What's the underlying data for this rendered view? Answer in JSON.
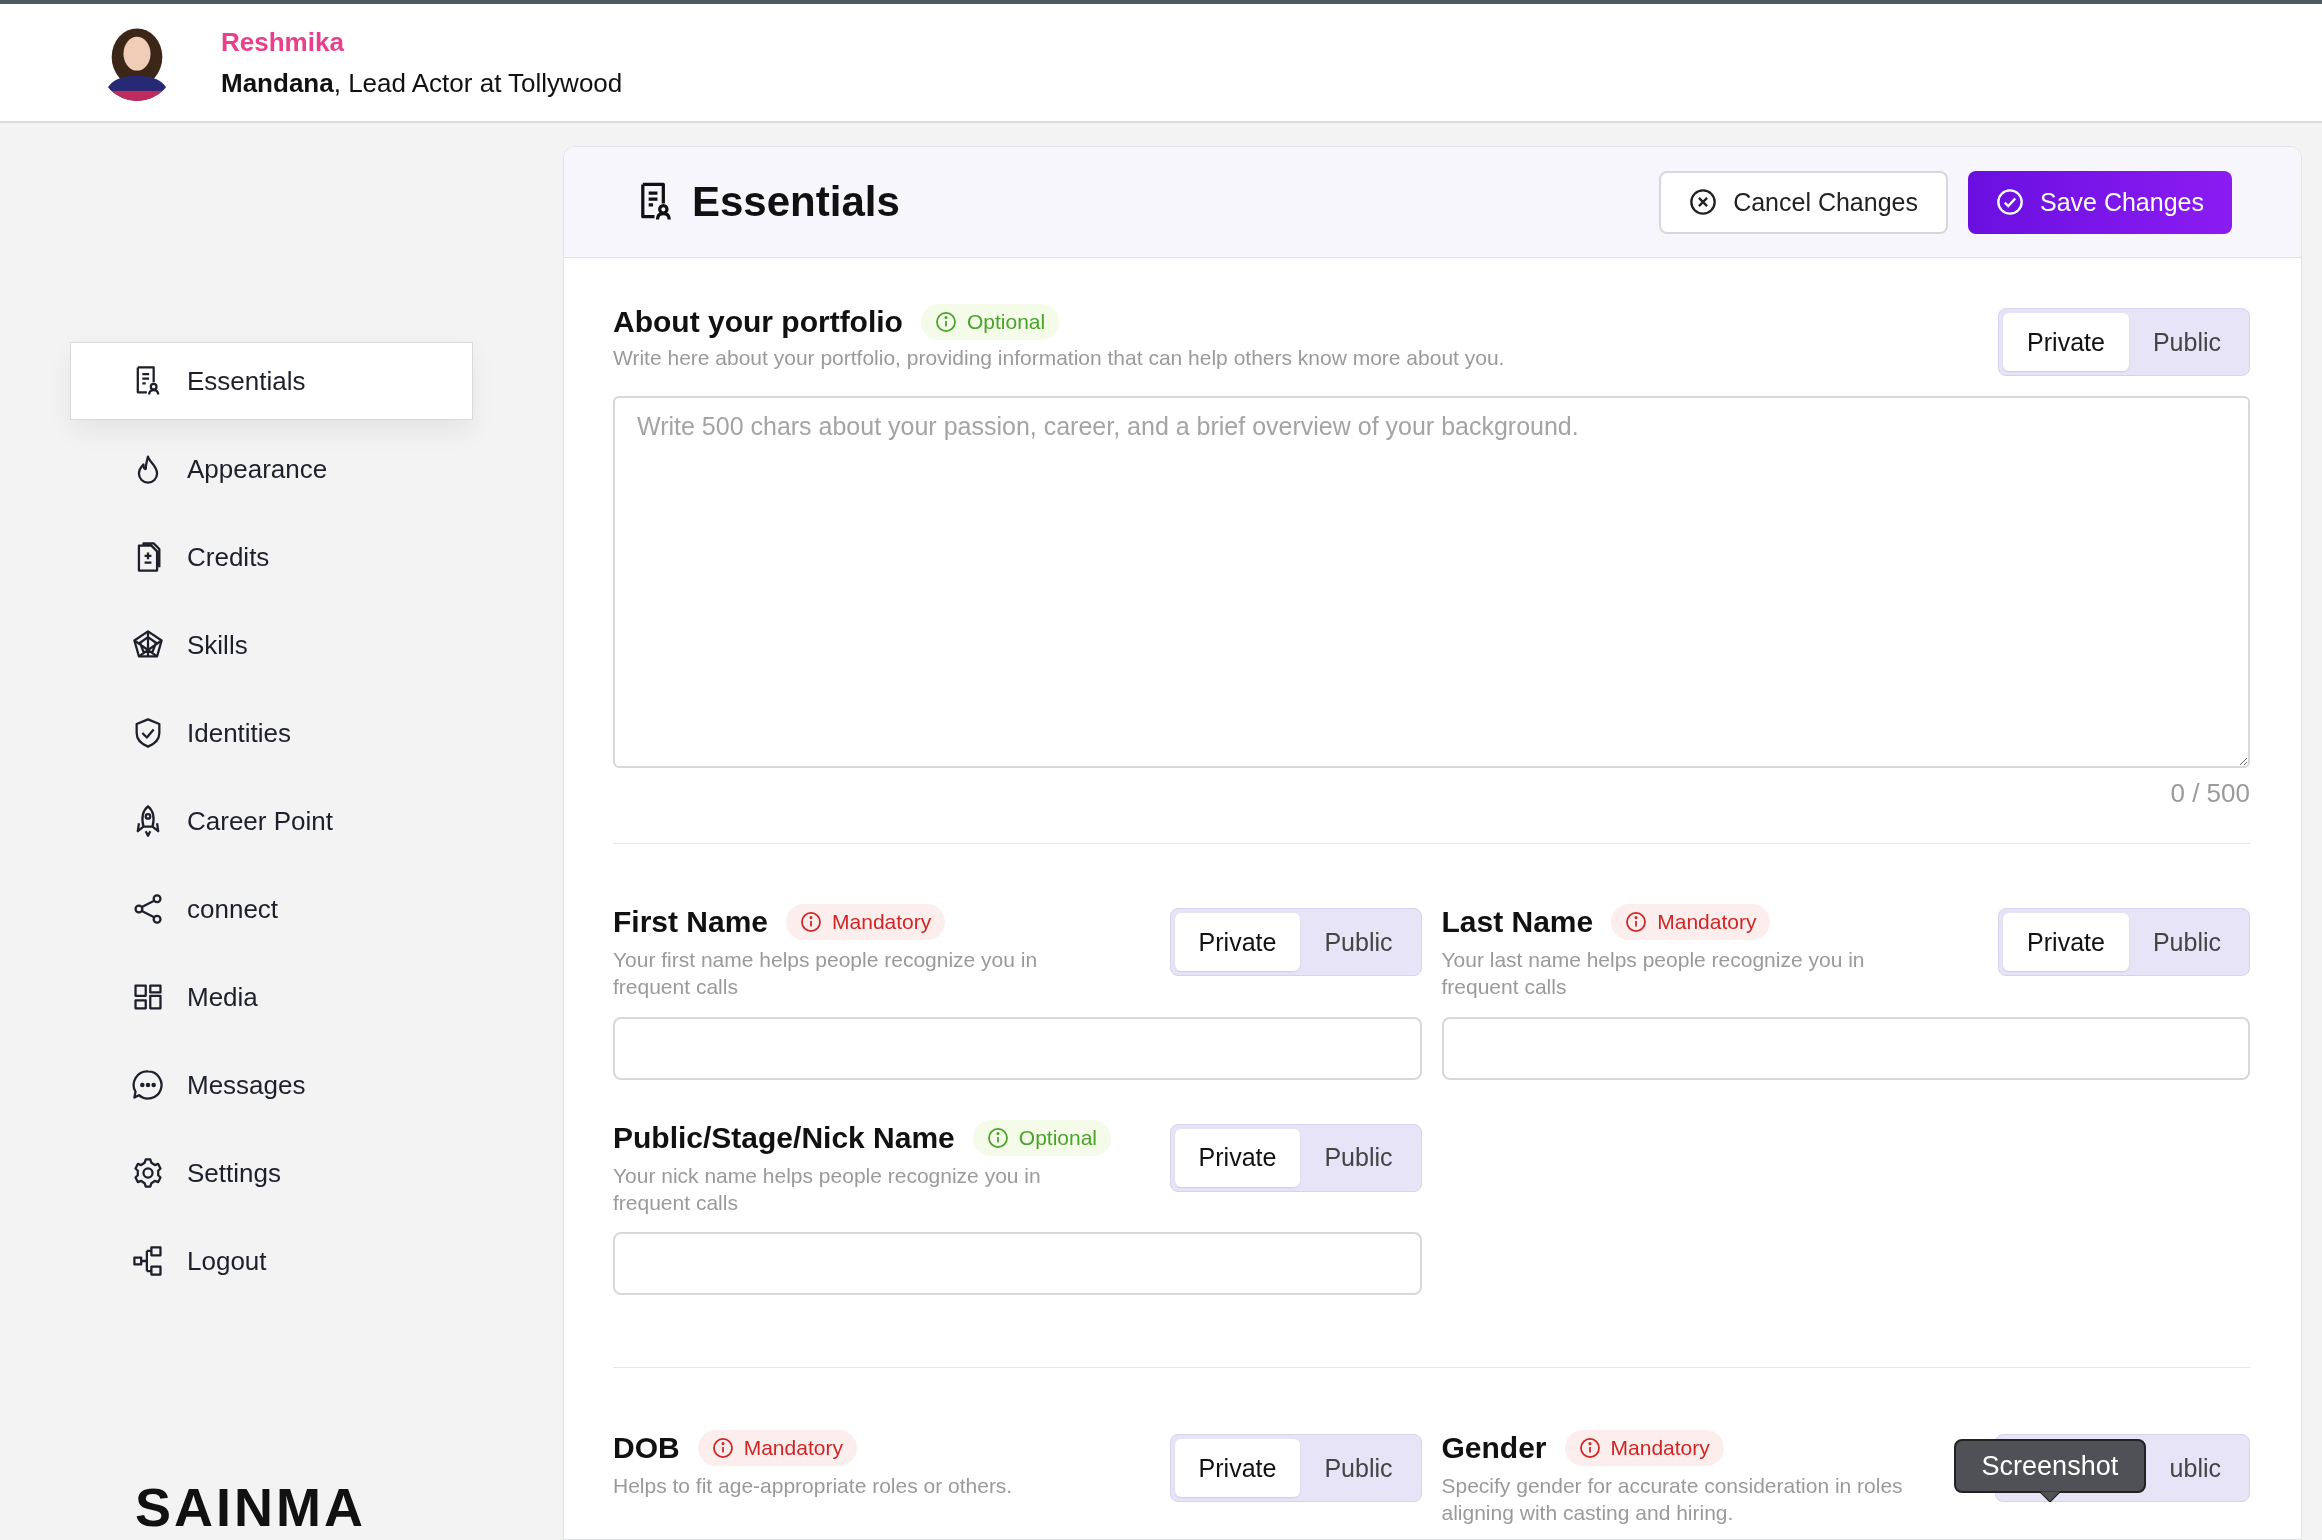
{
  "profile": {
    "first_name": "Reshmika",
    "last_name": "Mandana",
    "role": ", Lead Actor at Tollywood"
  },
  "sidebar": {
    "items": [
      {
        "label": "Essentials",
        "selected": true
      },
      {
        "label": "Appearance",
        "selected": false
      },
      {
        "label": "Credits",
        "selected": false
      },
      {
        "label": "Skills",
        "selected": false
      },
      {
        "label": "Identities",
        "selected": false
      },
      {
        "label": "Career Point",
        "selected": false
      },
      {
        "label": "connect",
        "selected": false
      },
      {
        "label": "Media",
        "selected": false
      },
      {
        "label": "Messages",
        "selected": false
      },
      {
        "label": "Settings",
        "selected": false
      },
      {
        "label": "Logout",
        "selected": false
      }
    ],
    "logo": "SAINMA"
  },
  "page": {
    "title": "Essentials",
    "buttons": [
      {
        "kind": "cancel",
        "label": "Cancel Changes"
      },
      {
        "kind": "save",
        "label": "Save Changes"
      }
    ]
  },
  "portfolio": {
    "title": "About your portfolio",
    "badge": {
      "kind": "optional",
      "label": "Optional"
    },
    "description": "Write here about your portfolio, providing information that can help others know more about you.",
    "privacy": [
      {
        "label": "Private",
        "selected": true
      },
      {
        "label": "Public",
        "selected": false
      }
    ],
    "placeholder": "Write 500 chars about your passion, career, and a brief overview of your background.",
    "counter": "0 / 500"
  },
  "fields": [
    {
      "title": "First Name",
      "badge": {
        "kind": "mandatory",
        "label": "Mandatory"
      },
      "description": "Your first name helps people recognize you in frequent calls",
      "privacy": [
        {
          "label": "Private",
          "selected": true
        },
        {
          "label": "Public",
          "selected": false
        }
      ]
    },
    {
      "title": "Last Name",
      "badge": {
        "kind": "mandatory",
        "label": "Mandatory"
      },
      "description": "Your last name helps people recognize you in frequent calls",
      "privacy": [
        {
          "label": "Private",
          "selected": true
        },
        {
          "label": "Public",
          "selected": false
        }
      ]
    },
    {
      "title": "Public/Stage/Nick Name",
      "badge": {
        "kind": "optional",
        "label": "Optional"
      },
      "description": "Your nick name helps people recognize you in frequent calls",
      "privacy": [
        {
          "label": "Private",
          "selected": true
        },
        {
          "label": "Public",
          "selected": false
        }
      ]
    }
  ],
  "bottom_fields": [
    {
      "title": "DOB",
      "badge": {
        "kind": "mandatory",
        "label": "Mandatory"
      },
      "description": "Helps to fit age-appropriate roles or others.",
      "privacy": [
        {
          "label": "Private",
          "selected": true
        },
        {
          "label": "Public",
          "selected": false
        }
      ]
    },
    {
      "title": "Gender",
      "badge": {
        "kind": "mandatory",
        "label": "Mandatory"
      },
      "description": "Specify gender for accurate consideration in roles aligning with casting and hiring.",
      "privacy": [
        {
          "label": "ublic",
          "selected": false
        }
      ],
      "tooltip": "Screenshot"
    }
  ]
}
